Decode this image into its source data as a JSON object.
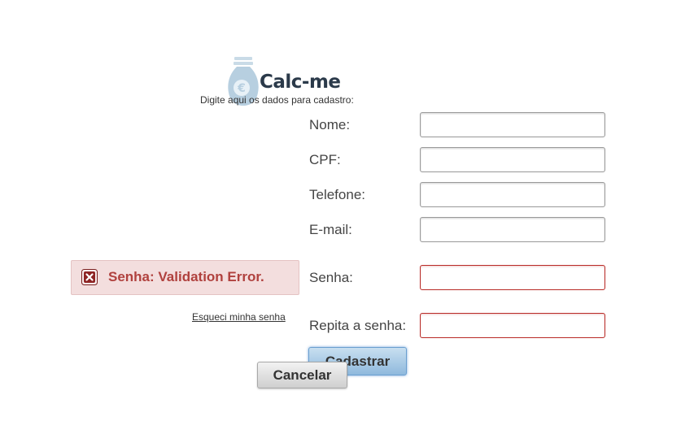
{
  "logo": {
    "text": "Calc-me"
  },
  "intro": "Digite aqui os dados para cadastro:",
  "form": {
    "nome_label": "Nome:",
    "nome_value": "",
    "cpf_label": "CPF:",
    "cpf_value": "",
    "telefone_label": "Telefone:",
    "telefone_value": "",
    "email_label": "E-mail:",
    "email_value": "",
    "senha_label": "Senha:",
    "senha_value": "",
    "repita_label": "Repita a senha:",
    "repita_value": ""
  },
  "error": {
    "message": "Senha: Validation Error."
  },
  "forgot_link": "Esqueci minha senha",
  "buttons": {
    "submit": "Cadastrar",
    "cancel": "Cancelar"
  },
  "colors": {
    "error_bg": "#f3dede",
    "error_text": "#b0413e",
    "error_border": "#b92c28",
    "submit_bg": "#8fb9dd"
  }
}
